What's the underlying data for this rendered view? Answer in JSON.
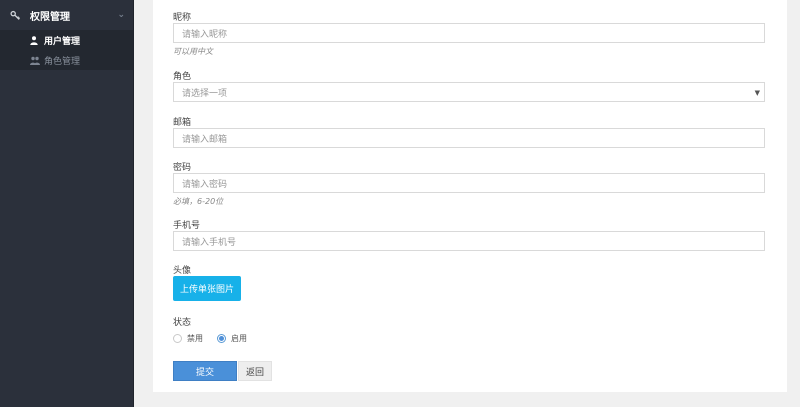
{
  "sidebar": {
    "menu": {
      "label": "权限管理",
      "icon": "key-icon",
      "expanded": true
    },
    "items": [
      {
        "label": "用户管理",
        "icon": "user-icon",
        "active": true
      },
      {
        "label": "角色管理",
        "icon": "users-icon",
        "active": false
      }
    ]
  },
  "form": {
    "nickname": {
      "label": "昵称",
      "placeholder": "请输入昵称",
      "help": "可以用中文"
    },
    "role": {
      "label": "角色",
      "placeholder": "请选择一项"
    },
    "email": {
      "label": "邮箱",
      "placeholder": "请输入邮箱"
    },
    "password": {
      "label": "密码",
      "placeholder": "请输入密码",
      "help": "必填，6-20位"
    },
    "phone": {
      "label": "手机号",
      "placeholder": "请输入手机号"
    },
    "avatar": {
      "label": "头像",
      "button": "上传单张图片"
    },
    "status": {
      "label": "状态",
      "options": [
        "禁用",
        "启用"
      ],
      "selected": "启用"
    },
    "submit": "提交",
    "back": "返回"
  },
  "colors": {
    "sidebar_bg": "#2b303b",
    "upload_btn": "#17b1e9",
    "submit_btn": "#4a90d9"
  }
}
